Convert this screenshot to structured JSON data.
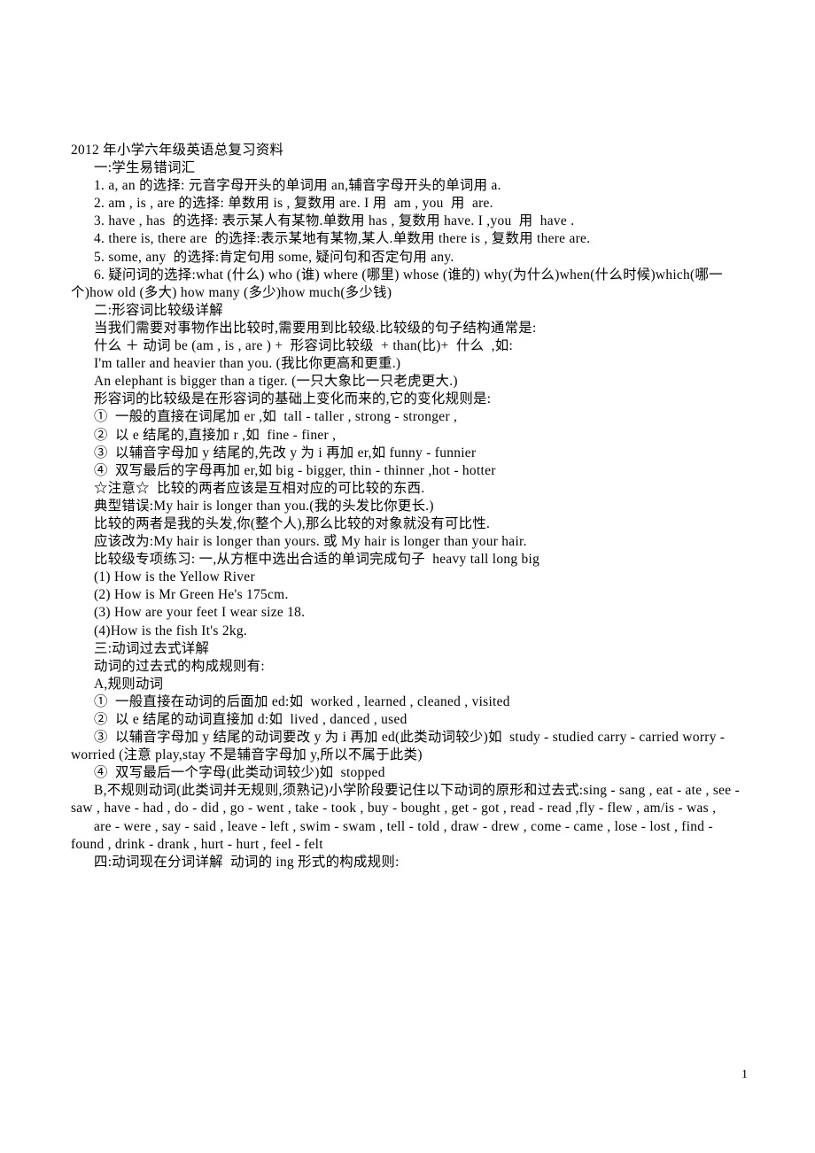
{
  "document": {
    "title": "2012 年小学六年级英语总复习资料",
    "page_number": "1",
    "lines": [
      {
        "id": "title",
        "indent": "none",
        "text": "2012 年小学六年级英语总复习资料"
      },
      {
        "id": "sec1",
        "indent": "first",
        "text": "一:学生易错词汇"
      },
      {
        "id": "s1-1",
        "indent": "first",
        "text": "1. a, an 的选择: 元音字母开头的单词用 an,辅音字母开头的单词用 a."
      },
      {
        "id": "s1-2",
        "indent": "first",
        "text": "2. am , is , are 的选择: 单数用 is , 复数用 are. I 用  am , you  用  are."
      },
      {
        "id": "s1-3",
        "indent": "first",
        "text": "3. have , has  的选择: 表示某人有某物.单数用 has , 复数用 have. I ,you  用  have ."
      },
      {
        "id": "s1-4",
        "indent": "first",
        "text": "4. there is, there are  的选择:表示某地有某物,某人.单数用 there is , 复数用 there are."
      },
      {
        "id": "s1-5",
        "indent": "first",
        "text": "5. some, any  的选择:肯定句用 some, 疑问句和否定句用 any."
      },
      {
        "id": "s1-6",
        "indent": "hang",
        "text": "6. 疑问词的选择:what (什么) who (谁) where (哪里) whose (谁的) why(为什么)when(什么时候)which(哪一个)how old (多大) how many (多少)how much(多少钱)"
      },
      {
        "id": "sec2",
        "indent": "first",
        "text": "二:形容词比较级详解"
      },
      {
        "id": "s2-1",
        "indent": "first",
        "text": "当我们需要对事物作出比较时,需要用到比较级.比较级的句子结构通常是:"
      },
      {
        "id": "s2-2",
        "indent": "first",
        "text": "什么 ＋ 动词 be (am , is , are ) +  形容词比较级  + than(比)+  什么  ,如:"
      },
      {
        "id": "s2-3",
        "indent": "first",
        "text": "I'm taller and heavier than you. (我比你更高和更重.)"
      },
      {
        "id": "s2-4",
        "indent": "first",
        "text": "An elephant is bigger than a tiger. (一只大象比一只老虎更大.)"
      },
      {
        "id": "s2-5",
        "indent": "first",
        "text": "形容词的比较级是在形容词的基础上变化而来的,它的变化规则是:"
      },
      {
        "id": "s2-6",
        "indent": "first",
        "text": "①  一般的直接在词尾加 er ,如  tall - taller , strong - stronger ,"
      },
      {
        "id": "s2-7",
        "indent": "first",
        "text": "②  以 e 结尾的,直接加 r ,如  fine - finer ,"
      },
      {
        "id": "s2-8",
        "indent": "first",
        "text": "③  以辅音字母加 y 结尾的,先改 y 为 i 再加 er,如 funny - funnier"
      },
      {
        "id": "s2-9",
        "indent": "first",
        "text": "④  双写最后的字母再加 er,如 big - bigger, thin - thinner ,hot - hotter"
      },
      {
        "id": "s2-10",
        "indent": "first",
        "text": "☆注意☆  比较的两者应该是互相对应的可比较的东西."
      },
      {
        "id": "s2-11",
        "indent": "first",
        "text": "典型错误:My hair is longer than you.(我的头发比你更长.)"
      },
      {
        "id": "s2-12",
        "indent": "first",
        "text": "比较的两者是我的头发,你(整个人),那么比较的对象就没有可比性."
      },
      {
        "id": "s2-13",
        "indent": "first",
        "text": "应该改为:My hair is longer than yours. 或 My hair is longer than your hair."
      },
      {
        "id": "s2-14",
        "indent": "first",
        "text": "比较级专项练习: 一,从方框中选出合适的单词完成句子  heavy tall long big"
      },
      {
        "id": "s2-q1",
        "indent": "first",
        "text": "(1) How is the Yellow River"
      },
      {
        "id": "s2-q2",
        "indent": "first",
        "text": "(2) How is Mr Green He's 175cm."
      },
      {
        "id": "s2-q3",
        "indent": "first",
        "text": "(3) How are your feet I wear size 18."
      },
      {
        "id": "s2-q4",
        "indent": "first",
        "text": "(4)How is the fish It's 2kg."
      },
      {
        "id": "sec3",
        "indent": "first",
        "text": "三:动词过去式详解"
      },
      {
        "id": "s3-1",
        "indent": "first",
        "text": "动词的过去式的构成规则有:"
      },
      {
        "id": "s3-2",
        "indent": "first",
        "text": "A,规则动词"
      },
      {
        "id": "s3-3",
        "indent": "first",
        "text": "①  一般直接在动词的后面加 ed:如  worked , learned , cleaned , visited"
      },
      {
        "id": "s3-4",
        "indent": "first",
        "text": "②  以 e 结尾的动词直接加 d:如  lived , danced , used"
      },
      {
        "id": "s3-5",
        "indent": "hang",
        "text": "③  以辅音字母加 y 结尾的动词要改 y 为 i 再加 ed(此类动词较少)如  study - studied carry - carried worry - worried (注意 play,stay 不是辅音字母加 y,所以不属于此类)"
      },
      {
        "id": "s3-6",
        "indent": "first",
        "text": "④  双写最后一个字母(此类动词较少)如  stopped"
      },
      {
        "id": "s3-7",
        "indent": "hang",
        "text": "B,不规则动词(此类词并无规则,须熟记)小学阶段要记住以下动词的原形和过去式:sing - sang , eat - ate , see - saw , have - had , do - did , go - went , take - took , buy - bought , get - got , read - read ,fly - flew , am/is - was ,"
      },
      {
        "id": "s3-8",
        "indent": "hang",
        "text": "are - were , say - said , leave - left , swim - swam , tell - told , draw - drew , come - came , lose - lost , find - found , drink - drank , hurt - hurt , feel - felt"
      },
      {
        "id": "sec4",
        "indent": "first",
        "text": "四:动词现在分词详解  动词的 ing 形式的构成规则:"
      }
    ]
  }
}
